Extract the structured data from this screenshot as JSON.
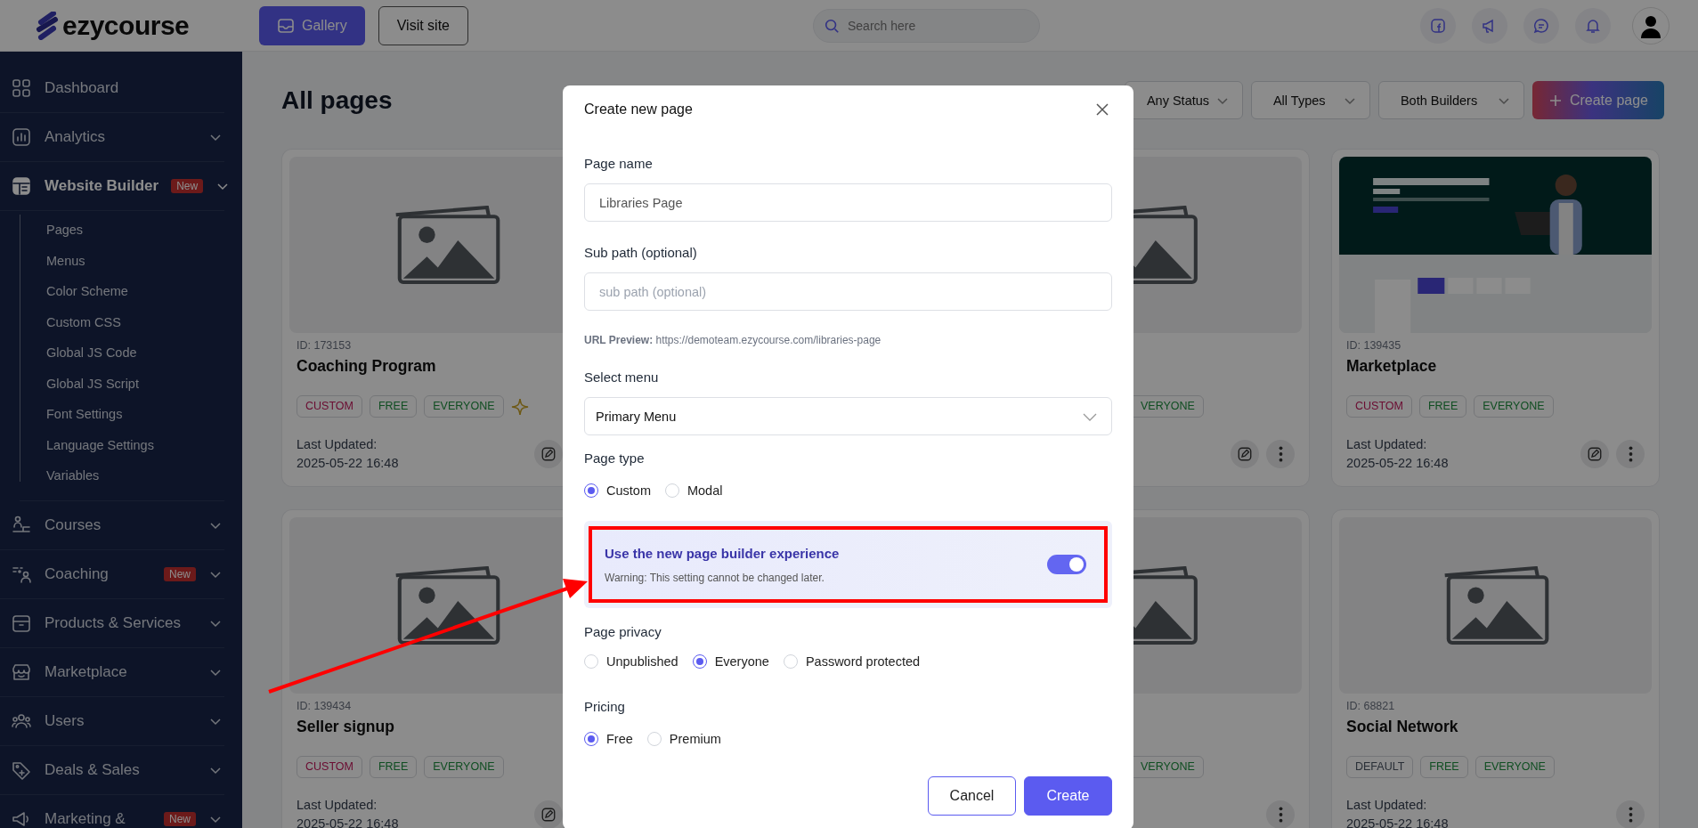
{
  "topbar": {
    "logo": "ezycourse",
    "buttons": [
      {
        "label": "Gallery",
        "kind": "primary"
      },
      {
        "label": "Visit site",
        "kind": "outline"
      }
    ],
    "search": {
      "placeholder": "Search here"
    }
  },
  "sidebar": {
    "items": [
      {
        "label": "Dashboard",
        "kind": "link",
        "selected": false
      },
      {
        "label": "Analytics",
        "kind": "group",
        "selected": false
      },
      {
        "label": "Website Builder",
        "kind": "group",
        "selected": true,
        "badge": "New",
        "children": [
          {
            "label": "Pages",
            "selected": false
          },
          {
            "label": "Menus",
            "selected": false
          },
          {
            "label": "Color Scheme",
            "selected": false
          },
          {
            "label": "Custom CSS",
            "selected": false
          },
          {
            "label": "Global JS Code",
            "selected": false
          },
          {
            "label": "Global JS Script",
            "selected": false
          },
          {
            "label": "Font Settings",
            "selected": false
          },
          {
            "label": "Language Settings",
            "selected": false
          },
          {
            "label": "Variables",
            "selected": false
          }
        ]
      },
      {
        "label": "Courses",
        "kind": "group",
        "selected": false
      },
      {
        "label": "Coaching",
        "kind": "group",
        "selected": false,
        "badge": "New"
      },
      {
        "label": "Products & Services",
        "kind": "group",
        "selected": false
      },
      {
        "label": "Marketplace",
        "kind": "group",
        "selected": false
      },
      {
        "label": "Users",
        "kind": "group",
        "selected": false
      },
      {
        "label": "Deals & Sales",
        "kind": "group",
        "selected": false
      },
      {
        "label": "Marketing &",
        "kind": "group",
        "selected": false,
        "badge": "New"
      }
    ]
  },
  "header": {
    "title": "All pages",
    "filters": [
      "Any Status",
      "All Types",
      "Both Builders"
    ],
    "create_button": "Create page"
  },
  "card_rows": [
    [
      {
        "thumbnail": {
          "kind": "placeholder"
        },
        "id": "ID: 173153",
        "title": "Coaching Program",
        "tags": [
          {
            "text": "CUSTOM",
            "kind": "custom"
          },
          {
            "text": "FREE",
            "kind": "price"
          },
          {
            "text": "EVERYONE",
            "kind": "audience"
          }
        ],
        "featured": true,
        "updated_label": "Last Updated:",
        "updated": "2025-05-22 16:48",
        "edit_button": true,
        "menu_button": false
      },
      {
        "thumbnail": {
          "kind": "placeholder"
        },
        "tags": [
          {
            "text": "VERYONE",
            "kind": "audience"
          }
        ],
        "featured": false,
        "edit_button": true,
        "menu_button": true
      },
      {
        "id": "ID: 139435",
        "title": "Marketplace",
        "tags": [
          {
            "text": "CUSTOM",
            "kind": "custom"
          },
          {
            "text": "FREE",
            "kind": "price"
          },
          {
            "text": "EVERYONE",
            "kind": "audience"
          }
        ],
        "featured": false,
        "updated_label": "Last Updated:",
        "updated": "2025-05-22 16:48",
        "edit_button": true,
        "menu_button": true
      }
    ],
    [
      {
        "thumbnail": {
          "kind": "placeholder"
        },
        "id": "ID: 139434",
        "title": "Seller signup",
        "tags": [
          {
            "text": "CUSTOM",
            "kind": "custom"
          },
          {
            "text": "FREE",
            "kind": "price"
          },
          {
            "text": "EVERYONE",
            "kind": "audience"
          }
        ],
        "featured": false,
        "updated_label": "Last Updated:",
        "updated": "2025-05-22 16:48",
        "edit_button": true,
        "menu_button": false
      },
      {
        "thumbnail": {
          "kind": "placeholder"
        },
        "tags": [
          {
            "text": "VERYONE",
            "kind": "audience"
          }
        ],
        "featured": false,
        "edit_button": false,
        "menu_button": true
      },
      {
        "thumbnail": {
          "kind": "placeholder"
        },
        "id": "ID: 68821",
        "title": "Social Network",
        "tags": [
          {
            "text": "DEFAULT",
            "kind": "default"
          },
          {
            "text": "FREE",
            "kind": "price"
          },
          {
            "text": "EVERYONE",
            "kind": "audience"
          }
        ],
        "featured": false,
        "updated_label": "Last Updated:",
        "updated": "2025-05-22 16:48",
        "edit_button": false,
        "menu_button": true
      }
    ]
  ],
  "modal": {
    "title": "Create new page",
    "fields": [
      {
        "label": "Page name",
        "value": "Libraries Page"
      },
      {
        "label": "Sub path (optional)",
        "placeholder": "sub path (optional)"
      }
    ],
    "url_preview": "**URL Preview:** https://demoteam.ezycourse.com/libraries-page",
    "select": {
      "label": "Select menu",
      "value": "Primary Menu"
    },
    "page_type": {
      "label": "Page type",
      "options": [
        {
          "label": "Custom",
          "selected": true
        },
        {
          "label": "Modal",
          "selected": false
        }
      ]
    },
    "builder": {
      "title": "Use the new page builder experience",
      "warning": "Warning: This setting cannot be changed later.",
      "on": true,
      "highlighted": true
    },
    "privacy": {
      "label": "Page privacy",
      "options": [
        {
          "label": "Unpublished",
          "selected": false
        },
        {
          "label": "Everyone",
          "selected": true
        },
        {
          "label": "Password protected",
          "selected": false
        }
      ]
    },
    "pricing": {
      "label": "Pricing",
      "options": [
        {
          "label": "Free",
          "selected": true
        },
        {
          "label": "Premium",
          "selected": false
        }
      ]
    },
    "buttons": [
      {
        "label": "Cancel",
        "kind": "secondary"
      },
      {
        "label": "Create",
        "kind": "primary"
      }
    ]
  }
}
